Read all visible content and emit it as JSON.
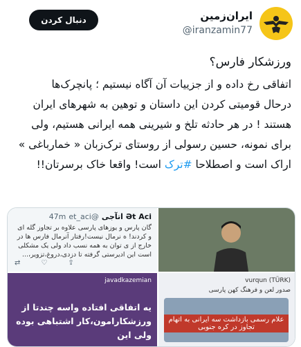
{
  "header": {
    "follow_label": "دنبال کردن",
    "display_name": "ایران‌زمین",
    "handle": "@iranzamin77"
  },
  "tweet": {
    "title": "ورزشکار فارس؟",
    "body_part1": "اتفاقی رخ داده و از جزییات آن آگاه نیستیم ؛ پانچرک‌ها\nدرحال قومیتی کردن این داستان و توهین به شهرهای ایران\nهستند ! در هر حادثه تلخ و شیرینی همه ایرانی هستیم، ولی\nبرای نمونه، حسین رسولی از روستای ترک‌زبان « خمارباغی »\nاراک است و اصطلاحا ",
    "hashtag": "#ترک",
    "body_part2": " است! واقعا خاک برسرتان!!"
  },
  "media": {
    "quote": {
      "name": "Ət Aci اتآجی",
      "handle": "@et_aci",
      "time": "47m",
      "text": "گان پارس و یوزهای پارسی علاوه بر تجاوز گله ای و کردند! ه نرمال نیست!رفتار آنرمال فارس ها در خارج از ی توان به همه نسب داد ولی یک مشکلی است این ادیرستی گرفته تا دزدی،دروغ،تزویر،..."
    },
    "story": {
      "user": "javadkazemian",
      "text": "یه اتفاقی افتاده واسه چندتا از ورزشکارامون،کار اشتباهی بوده ولی این"
    },
    "news": {
      "handle": "vurqun (TÜRK)",
      "subtitle": "صدور لعن و فرهنگ کهن پارسی",
      "banner": "علام رسمی بازداشت سه ایرانی به اتهام تجاوز در کره جنوبی"
    }
  }
}
